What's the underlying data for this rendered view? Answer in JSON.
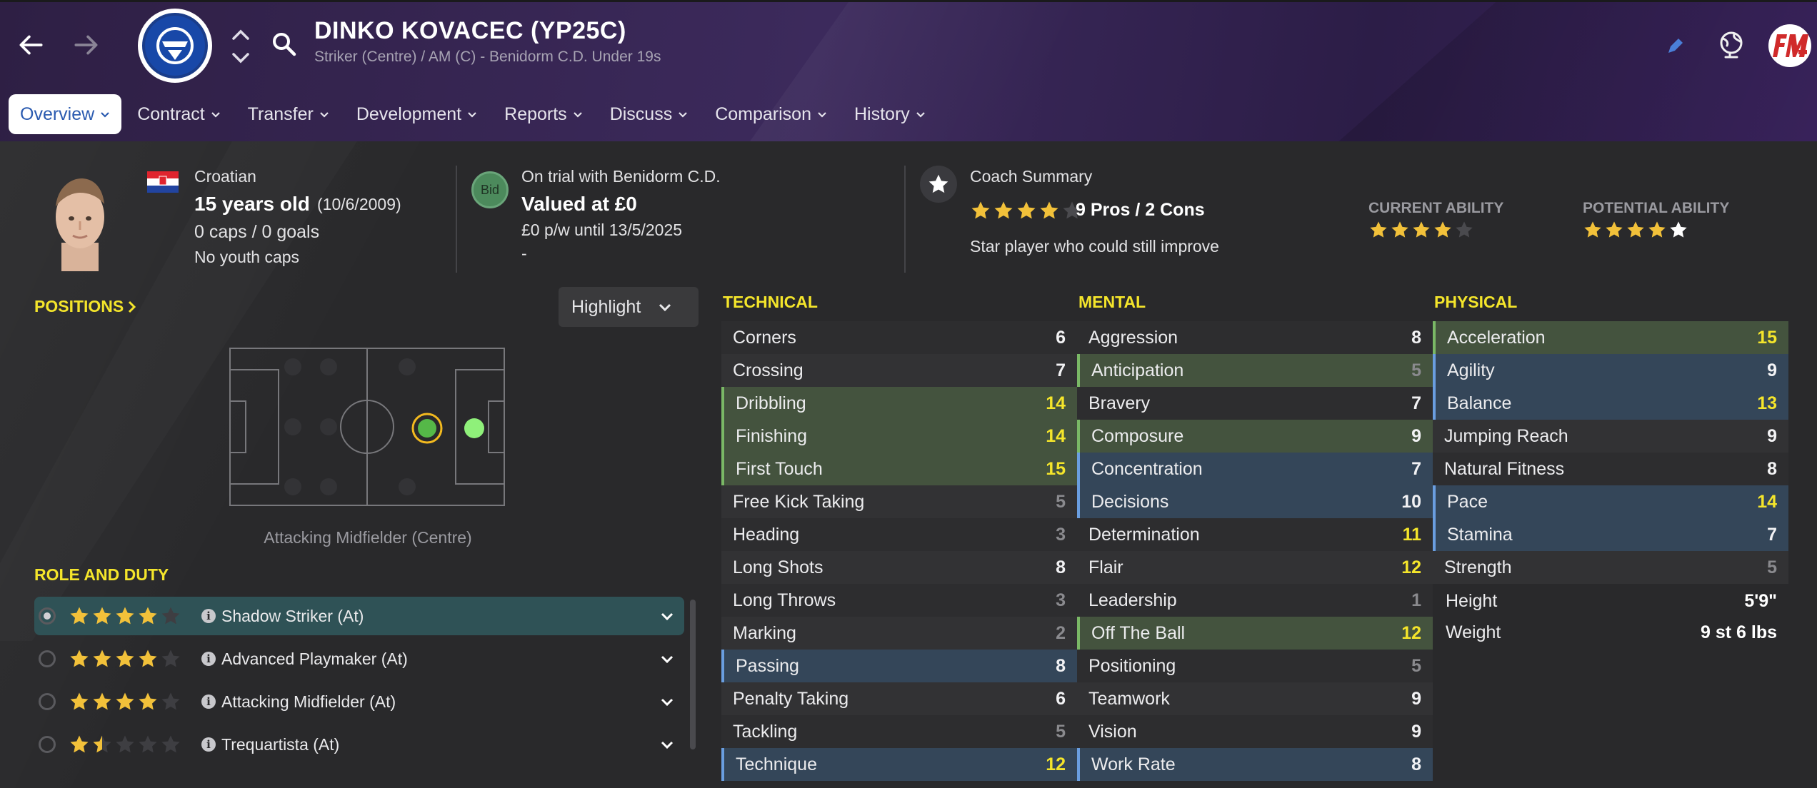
{
  "header": {
    "player_name": "DINKO KOVACEC (YP25C)",
    "subtitle": "Striker (Centre) / AM (C) - Benidorm C.D. Under 19s"
  },
  "tabs": [
    {
      "label": "Overview"
    },
    {
      "label": "Contract"
    },
    {
      "label": "Transfer"
    },
    {
      "label": "Development"
    },
    {
      "label": "Reports"
    },
    {
      "label": "Discuss"
    },
    {
      "label": "Comparison"
    },
    {
      "label": "History"
    }
  ],
  "info": {
    "nationality": "Croatian",
    "age": "15 years old",
    "dob": "(10/6/2009)",
    "caps": "0 caps / 0 goals",
    "youth_caps": "No youth caps",
    "bid_label": "Bid",
    "trial": "On trial with Benidorm C.D.",
    "value": "Valued at £0",
    "wage": "£0 p/w until 13/5/2025",
    "dash": "-",
    "coach_title": "Coach Summary",
    "coach_stars": 4,
    "pros_cons": "9 Pros / 2 Cons",
    "coach_text": "Star player who could still improve",
    "ca_label": "CURRENT ABILITY",
    "ca_stars": 4,
    "pa_label": "POTENTIAL ABILITY",
    "pa_stars": 4.5
  },
  "positions": {
    "title": "POSITIONS",
    "highlight_label": "Highlight",
    "position_caption": "Attacking Midfielder (Centre)"
  },
  "roles": {
    "title": "ROLE AND DUTY",
    "items": [
      {
        "name": "Shadow Striker (At)",
        "stars": 4,
        "selected": true
      },
      {
        "name": "Advanced Playmaker (At)",
        "stars": 4,
        "selected": false
      },
      {
        "name": "Attacking Midfielder (At)",
        "stars": 4,
        "selected": false
      },
      {
        "name": "Trequartista (At)",
        "stars": 1.5,
        "selected": false
      }
    ]
  },
  "technical": {
    "title": "TECHNICAL",
    "rows": [
      {
        "name": "Corners",
        "value": "6",
        "hl": ""
      },
      {
        "name": "Crossing",
        "value": "7",
        "hl": ""
      },
      {
        "name": "Dribbling",
        "value": "14",
        "hl": "green"
      },
      {
        "name": "Finishing",
        "value": "14",
        "hl": "green"
      },
      {
        "name": "First Touch",
        "value": "15",
        "hl": "green"
      },
      {
        "name": "Free Kick Taking",
        "value": "5",
        "hl": ""
      },
      {
        "name": "Heading",
        "value": "3",
        "hl": ""
      },
      {
        "name": "Long Shots",
        "value": "8",
        "hl": ""
      },
      {
        "name": "Long Throws",
        "value": "3",
        "hl": ""
      },
      {
        "name": "Marking",
        "value": "2",
        "hl": ""
      },
      {
        "name": "Passing",
        "value": "8",
        "hl": "blue"
      },
      {
        "name": "Penalty Taking",
        "value": "6",
        "hl": ""
      },
      {
        "name": "Tackling",
        "value": "5",
        "hl": ""
      },
      {
        "name": "Technique",
        "value": "12",
        "hl": "blue"
      }
    ]
  },
  "mental": {
    "title": "MENTAL",
    "rows": [
      {
        "name": "Aggression",
        "value": "8",
        "hl": ""
      },
      {
        "name": "Anticipation",
        "value": "5",
        "hl": "green"
      },
      {
        "name": "Bravery",
        "value": "7",
        "hl": ""
      },
      {
        "name": "Composure",
        "value": "9",
        "hl": "green"
      },
      {
        "name": "Concentration",
        "value": "7",
        "hl": "blue"
      },
      {
        "name": "Decisions",
        "value": "10",
        "hl": "blue"
      },
      {
        "name": "Determination",
        "value": "11",
        "hl": ""
      },
      {
        "name": "Flair",
        "value": "12",
        "hl": ""
      },
      {
        "name": "Leadership",
        "value": "1",
        "hl": ""
      },
      {
        "name": "Off The Ball",
        "value": "12",
        "hl": "green"
      },
      {
        "name": "Positioning",
        "value": "5",
        "hl": ""
      },
      {
        "name": "Teamwork",
        "value": "9",
        "hl": ""
      },
      {
        "name": "Vision",
        "value": "9",
        "hl": ""
      },
      {
        "name": "Work Rate",
        "value": "8",
        "hl": "blue"
      }
    ]
  },
  "physical": {
    "title": "PHYSICAL",
    "rows": [
      {
        "name": "Acceleration",
        "value": "15",
        "hl": "green"
      },
      {
        "name": "Agility",
        "value": "9",
        "hl": "blue"
      },
      {
        "name": "Balance",
        "value": "13",
        "hl": "blue"
      },
      {
        "name": "Jumping Reach",
        "value": "9",
        "hl": ""
      },
      {
        "name": "Natural Fitness",
        "value": "8",
        "hl": ""
      },
      {
        "name": "Pace",
        "value": "14",
        "hl": "blue"
      },
      {
        "name": "Stamina",
        "value": "7",
        "hl": "blue"
      },
      {
        "name": "Strength",
        "value": "5",
        "hl": ""
      }
    ],
    "height_label": "Height",
    "height": "5'9\"",
    "weight_label": "Weight",
    "weight": "9 st 6 lbs"
  },
  "colors": {
    "accent_yellow": "#f4e52b",
    "star": "#f2c13a",
    "green_highlight": "#44533e",
    "blue_highlight": "#344659"
  }
}
